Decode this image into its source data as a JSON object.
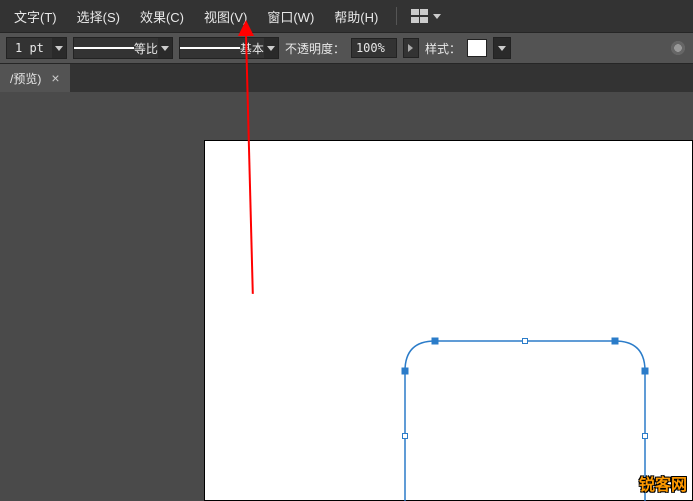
{
  "menu": {
    "text": "文字(T)",
    "select": "选择(S)",
    "effect": "效果(C)",
    "view": "视图(V)",
    "window": "窗口(W)",
    "help": "帮助(H)"
  },
  "options": {
    "stroke_weight": "1 pt",
    "stroke_profile": "等比",
    "brush": "基本",
    "opacity_label": "不透明度：",
    "opacity_value": "100%",
    "style_label": "样式："
  },
  "tab": {
    "title": "/预览)",
    "close": "×"
  },
  "watermark": "锐客网",
  "annotation": {
    "target": "view-menu"
  }
}
